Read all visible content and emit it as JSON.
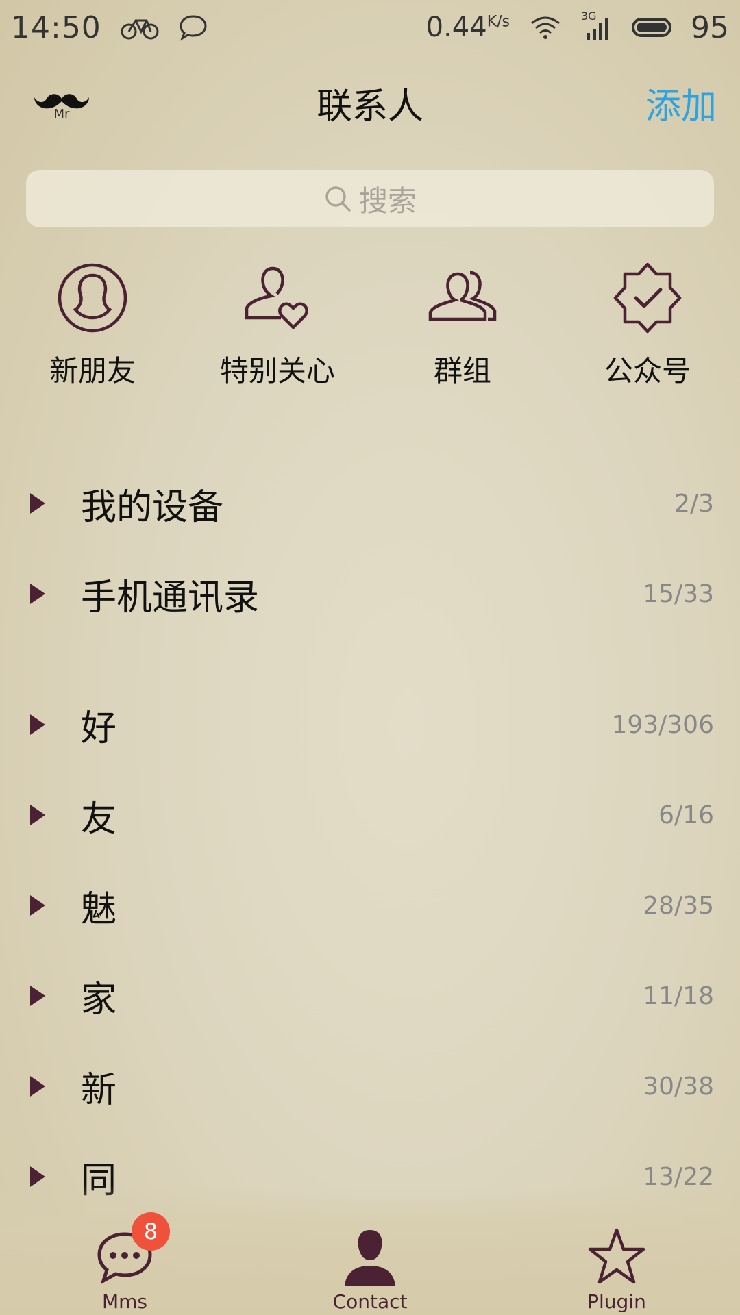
{
  "status_bar": {
    "time": "14:50",
    "speed": "0.44",
    "speed_unit": "K/s",
    "network": "3G",
    "battery": "95"
  },
  "header": {
    "logo_text": "Mr",
    "title": "联系人",
    "add_label": "添加"
  },
  "search": {
    "placeholder": "搜索"
  },
  "quick_actions": [
    {
      "label": "新朋友",
      "icon": "person-circle-icon"
    },
    {
      "label": "特别关心",
      "icon": "person-heart-icon"
    },
    {
      "label": "群组",
      "icon": "group-icon"
    },
    {
      "label": "公众号",
      "icon": "verified-badge-icon"
    }
  ],
  "groups": [
    {
      "name": "我的设备",
      "count": "2/3"
    },
    {
      "name": "手机通讯录",
      "count": "15/33"
    },
    {
      "name": "好",
      "count": "193/306"
    },
    {
      "name": "友",
      "count": "6/16"
    },
    {
      "name": "魅",
      "count": "28/35"
    },
    {
      "name": "家",
      "count": "11/18"
    },
    {
      "name": "新",
      "count": "30/38"
    },
    {
      "name": "同",
      "count": "13/22"
    }
  ],
  "tabs": [
    {
      "label": "Mms",
      "badge": "8",
      "icon": "chat-bubble-icon"
    },
    {
      "label": "Contact",
      "icon": "contact-person-icon"
    },
    {
      "label": "Plugin",
      "icon": "star-icon"
    }
  ],
  "colors": {
    "accent": "#2ba4e0",
    "icon": "#4a2233",
    "badge": "#f0513a"
  }
}
